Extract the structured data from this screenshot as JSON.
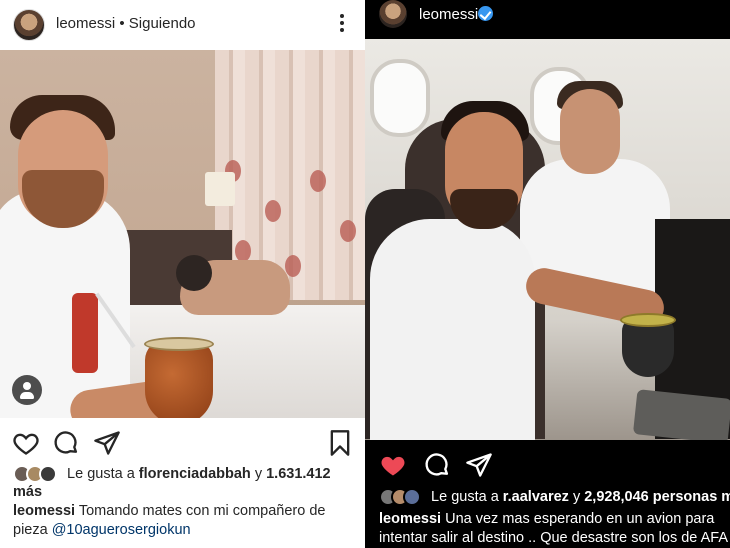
{
  "left_post": {
    "username": "leomessi",
    "follow_status": "• Siguiendo",
    "likes": {
      "prefix": "Le gusta a",
      "liker": "florenciadabbah",
      "conjunction": "y",
      "count": "1.631.412",
      "suffix": "más"
    },
    "caption": {
      "username": "leomessi",
      "text": "Tomando mates con mi compañero de pieza",
      "mention": "@10aguerosergiokun"
    }
  },
  "right_post": {
    "username": "leomessi",
    "likes": {
      "prefix": "Le gusta a",
      "liker": "r.aalvarez",
      "conjunction": "y",
      "count": "2,928,046",
      "suffix": "personas más"
    },
    "caption": {
      "username": "leomessi",
      "text": "Una vez mas esperando en un avion para intentar salir al destino .. Que desastre son los de AFA por dios !!!!"
    }
  },
  "colors": {
    "like_active": "#ed4956",
    "verified": "#3897f0",
    "mention": "#003569"
  },
  "icons": [
    "more-options-icon",
    "heart-icon",
    "comment-icon",
    "share-icon",
    "bookmark-icon",
    "tag-user-icon",
    "verified-badge-icon"
  ]
}
